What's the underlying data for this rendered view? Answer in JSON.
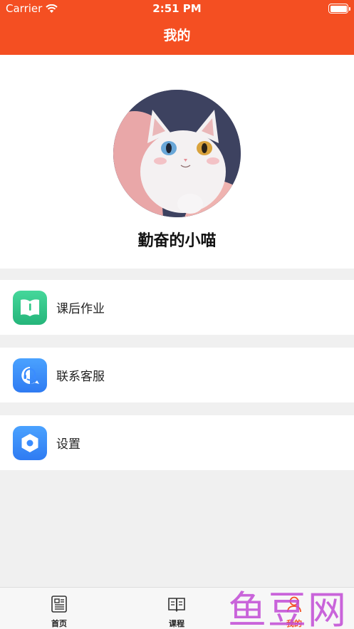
{
  "status_bar": {
    "carrier": "Carrier",
    "time": "2:51 PM"
  },
  "header": {
    "title": "我的"
  },
  "profile": {
    "username": "勤奋的小喵"
  },
  "menu": [
    {
      "label": "课后作业",
      "icon": "book-icon",
      "color": "#2fc685"
    },
    {
      "label": "联系客服",
      "icon": "headset-chat-icon",
      "color": "#3a8cff"
    },
    {
      "label": "设置",
      "icon": "hexagon-settings-icon",
      "color": "#3a8cff"
    }
  ],
  "tabs": [
    {
      "label": "首页",
      "icon": "newspaper-icon"
    },
    {
      "label": "课程",
      "icon": "open-book-icon"
    },
    {
      "label": "我的",
      "icon": "person-icon",
      "active": true
    }
  ],
  "accent_color": "#f44f22",
  "watermark": "鱼豆网"
}
